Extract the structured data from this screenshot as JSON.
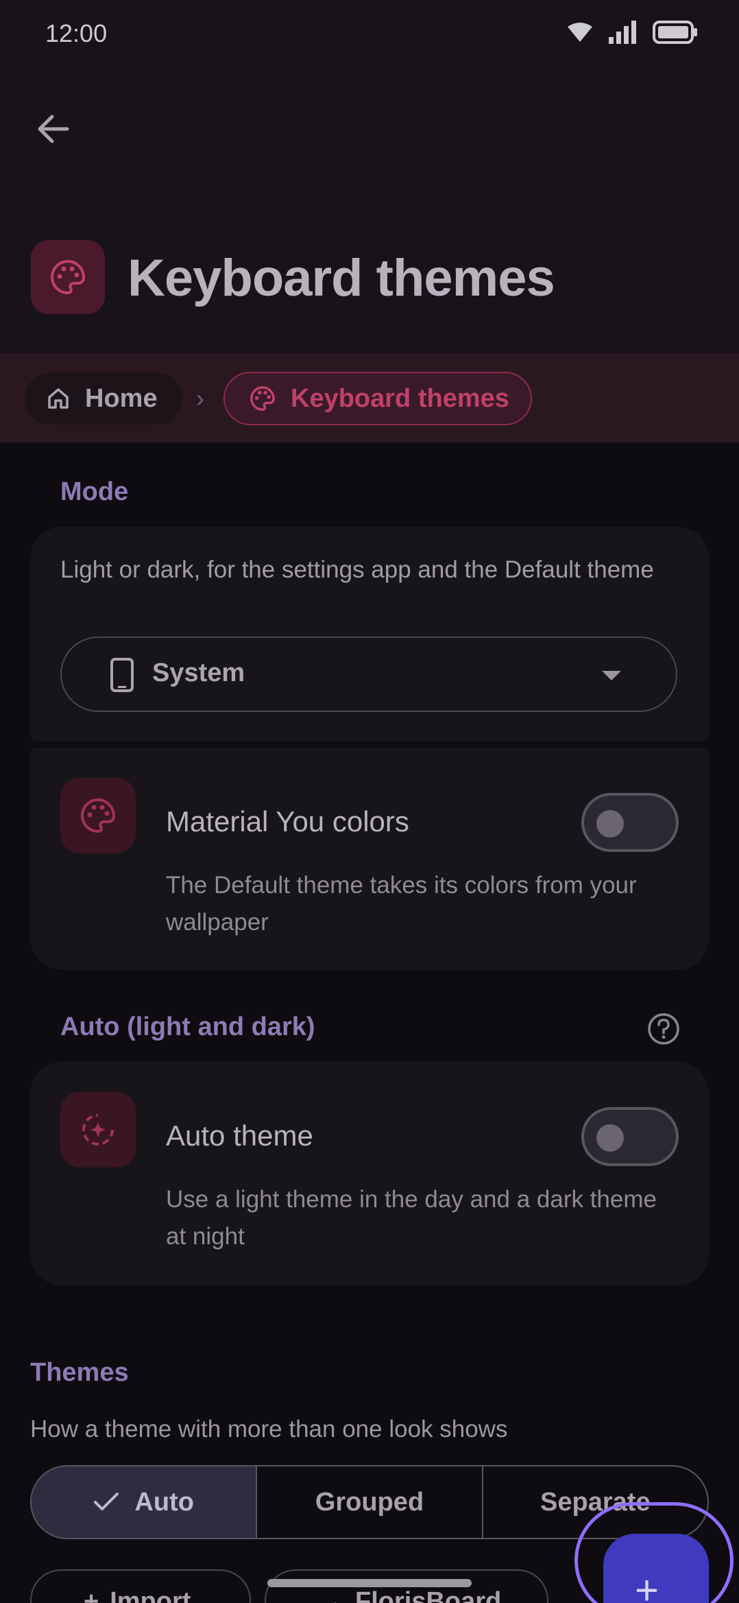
{
  "status_bar": {
    "time": "12:00"
  },
  "header": {
    "title": "Keyboard themes"
  },
  "breadcrumb": {
    "home": "Home",
    "current": "Keyboard themes"
  },
  "mode": {
    "section_label": "Mode",
    "description": "Light or dark, for the settings app and the Default theme",
    "dropdown_value": "System",
    "material_you": {
      "title": "Material You colors",
      "description": "The Default theme takes its colors from your wallpaper",
      "enabled": false
    }
  },
  "auto": {
    "section_label": "Auto (light and dark)",
    "auto_theme": {
      "title": "Auto theme",
      "description": "Use a light theme in the day and a dark theme at night",
      "enabled": false
    }
  },
  "themes": {
    "section_label": "Themes",
    "description": "How a theme with more than one look shows",
    "segments": [
      "Auto",
      "Grouped",
      "Separate"
    ],
    "selected_segment": "Auto",
    "bottom_buttons": [
      "Import",
      "FlorisBoard"
    ]
  },
  "colors": {
    "accent_pink": "#c0406c",
    "accent_purple": "#8d7bb5",
    "fab": "#3f3ac0"
  }
}
